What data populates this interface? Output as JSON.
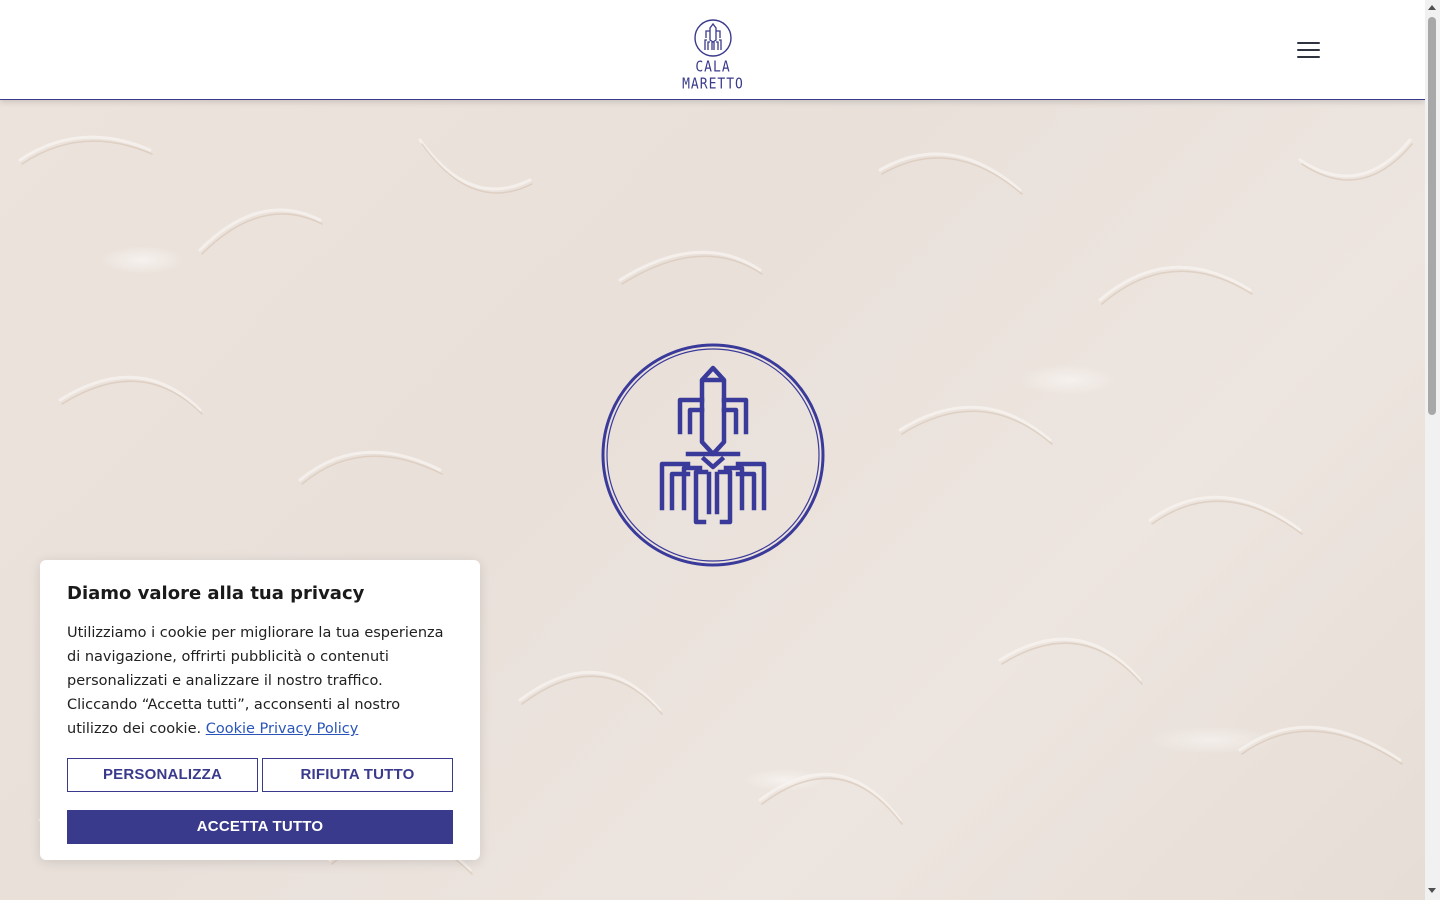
{
  "header": {
    "brand_name": "CALA MARETTO",
    "menu_icon": "hamburger-menu-icon"
  },
  "hero": {
    "logo_icon": "squid-emblem-icon"
  },
  "cookie_banner": {
    "title": "Diamo valore alla tua privacy",
    "body": "Utilizziamo i cookie per migliorare la tua esperienza di navigazione, offrirti pubblicità o contenuti personalizzati e analizzare il nostro traffico. Cliccando “Accetta tutti”, acconsenti al nostro utilizzo dei cookie.",
    "policy_link": "Cookie Privacy Policy",
    "customize_label": "PERSONALIZZA",
    "reject_label": "RIFIUTA TUTTO",
    "accept_label": "ACCETTA TUTTO"
  },
  "colors": {
    "brand": "#3a3a8c",
    "link": "#2a55b8",
    "background": "#ece4de"
  }
}
